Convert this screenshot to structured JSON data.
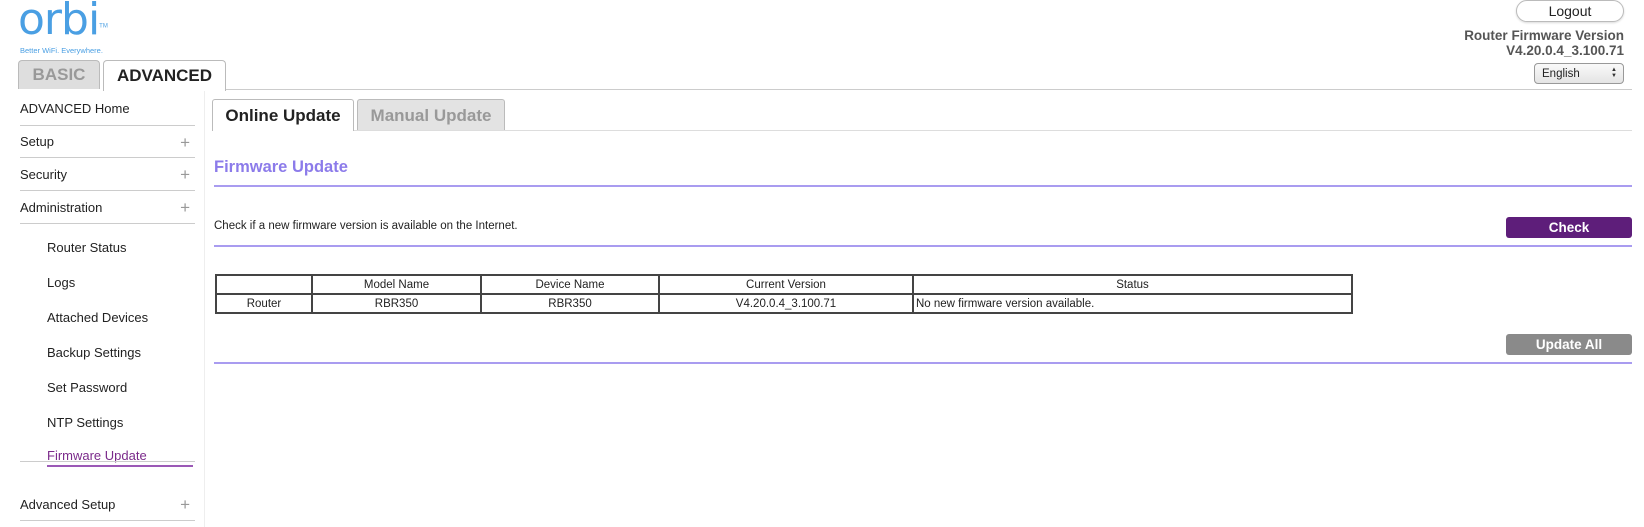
{
  "logo": {
    "word": "orbi",
    "tm": "TM",
    "tagline": "Better WiFi. Everywhere."
  },
  "header": {
    "logout_label": "Logout",
    "fw_label": "Router Firmware Version",
    "fw_value": "V4.20.0.4_3.100.71",
    "language": "English"
  },
  "top_tabs": {
    "basic": "BASIC",
    "advanced": "ADVANCED"
  },
  "sidebar": {
    "items": [
      {
        "label": "ADVANCED Home"
      },
      {
        "label": "Setup"
      },
      {
        "label": "Security"
      },
      {
        "label": "Administration"
      }
    ],
    "admin_sub": [
      {
        "label": "Router Status"
      },
      {
        "label": "Logs"
      },
      {
        "label": "Attached Devices"
      },
      {
        "label": "Backup Settings"
      },
      {
        "label": "Set Password"
      },
      {
        "label": "NTP Settings"
      },
      {
        "label": "Firmware Update"
      }
    ],
    "advanced_setup": "Advanced Setup",
    "active_item": "Firmware Update"
  },
  "content_tabs": {
    "online": "Online Update",
    "manual": "Manual Update"
  },
  "section": {
    "title": "Firmware Update",
    "description": "Check if a new firmware version is available on the Internet.",
    "check_label": "Check",
    "update_all_label": "Update All"
  },
  "table": {
    "headers": [
      "",
      "Model Name",
      "Device Name",
      "Current Version",
      "Status"
    ],
    "rows": [
      [
        "Router",
        "RBR350",
        "RBR350",
        "V4.20.0.4_3.100.71",
        "No new firmware version available."
      ]
    ]
  },
  "colors": {
    "accent_purple": "#5e1e7a",
    "title_purple": "#8c7bea",
    "logo_blue": "#4a9fe3",
    "active_link": "#7b2a8b"
  }
}
